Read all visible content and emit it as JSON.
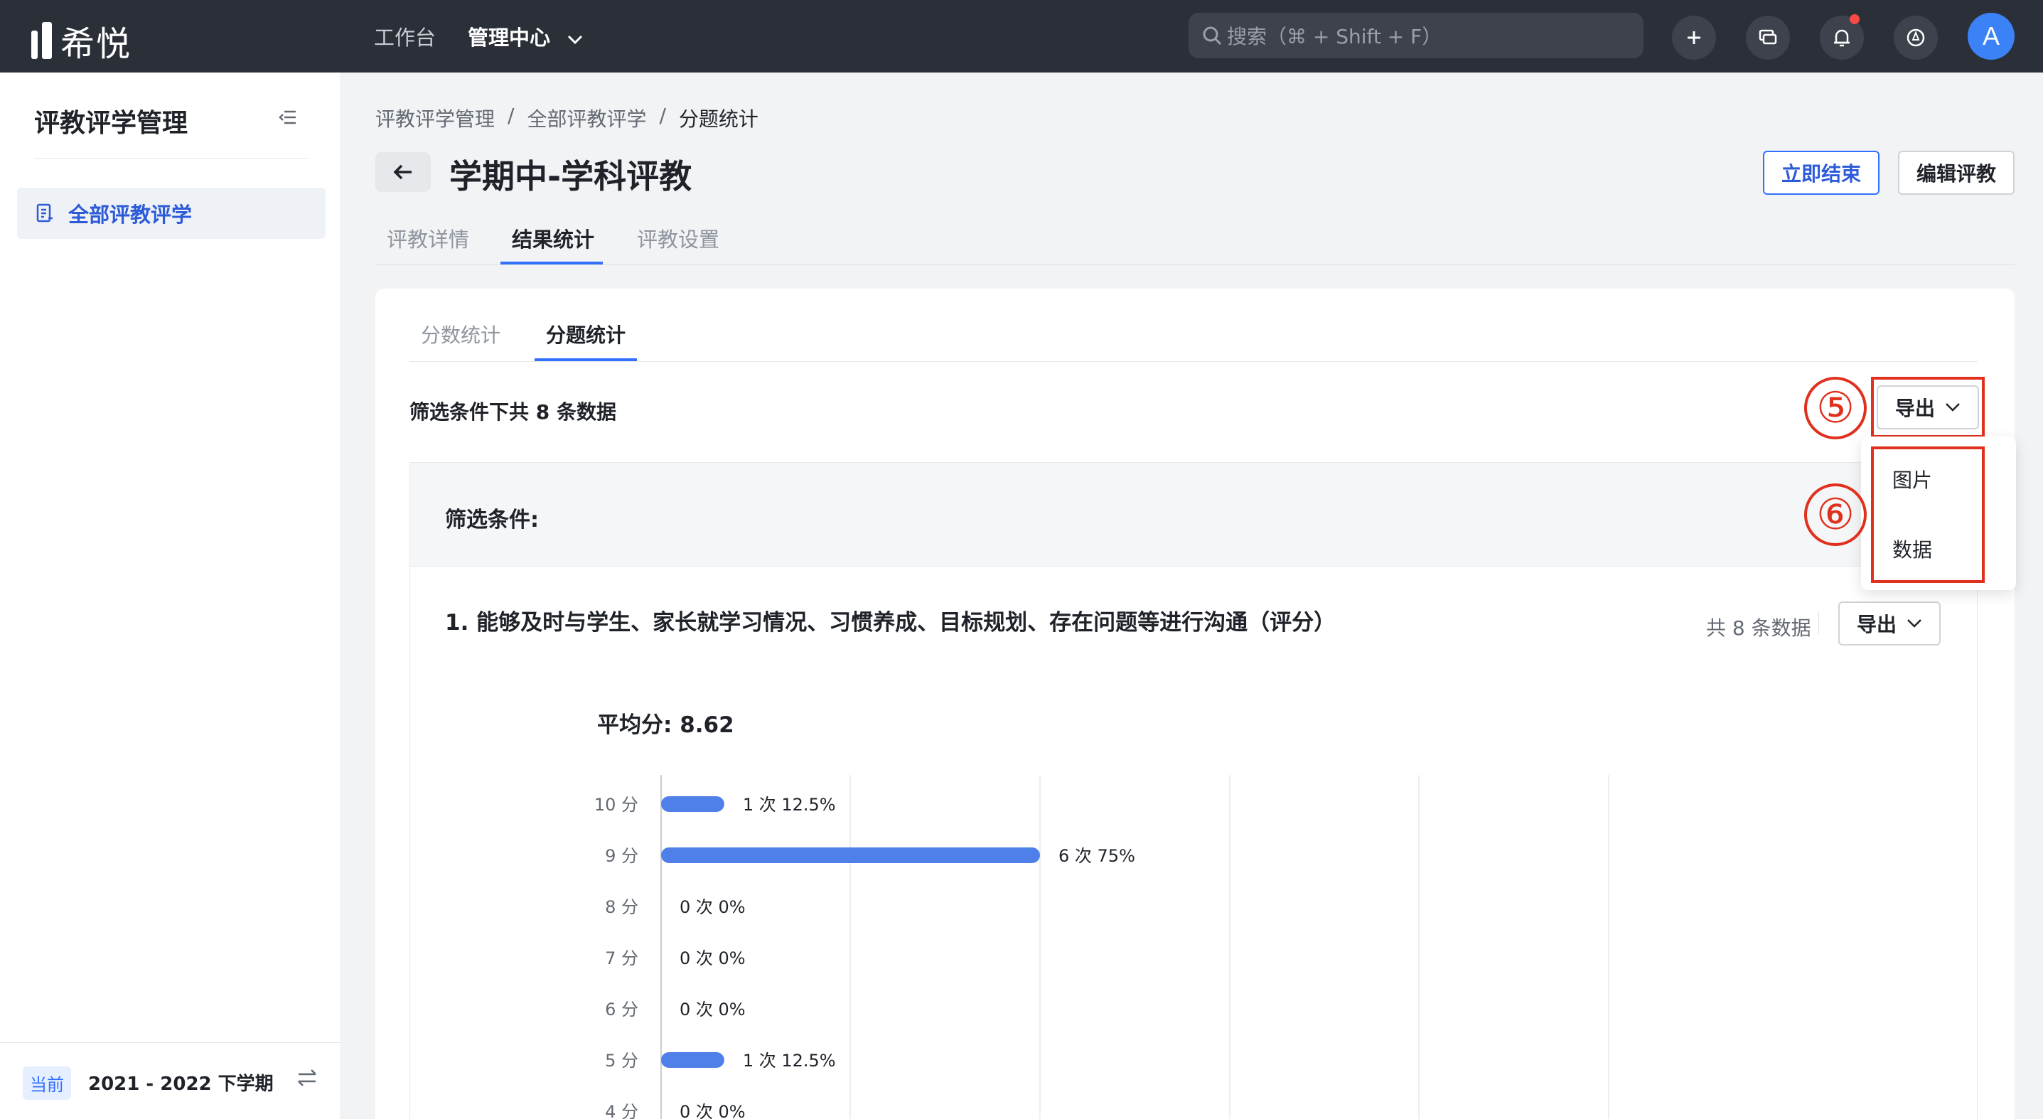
{
  "topnav": {
    "logo_text": "希悦",
    "links": [
      "工作台",
      "管理中心"
    ],
    "search_placeholder": "搜索（⌘ + Shift + F）",
    "avatar_initial": "A"
  },
  "sidebar": {
    "title": "评教评学管理",
    "items": [
      {
        "label": "全部评教评学"
      }
    ],
    "term_badge": "当前",
    "term_text": "2021 - 2022 下学期"
  },
  "breadcrumb": [
    "评教评学管理",
    "/",
    "全部评教评学",
    "/",
    "分题统计"
  ],
  "page": {
    "title": "学期中-学科评教",
    "end_now": "立即结束",
    "edit": "编辑评教",
    "tabs": [
      "评教详情",
      "结果统计",
      "评教设置"
    ]
  },
  "card": {
    "subtabs": [
      "分数统计",
      "分题统计"
    ],
    "count_text": "筛选条件下共 8 条数据",
    "export_label": "导出",
    "export_menu": [
      "图片",
      "数据"
    ],
    "annotations": [
      "⑤",
      "⑥"
    ],
    "filter_label": "筛选条件:",
    "question": {
      "title": "1. 能够及时与学生、家长就学习情况、习惯养成、目标规划、存在问题等进行沟通（评分）",
      "count": "共 8 条数据",
      "export_label": "导出",
      "average": "平均分: 8.62"
    }
  },
  "colors": {
    "accent": "#3370ff",
    "bar": "#4f7fe8",
    "annotation": "#e0301e",
    "nav_bg": "#2b2f38"
  },
  "chart_data": {
    "type": "bar",
    "orientation": "horizontal",
    "categories": [
      "10 分",
      "9 分",
      "8 分",
      "7 分",
      "6 分",
      "5 分",
      "4 分"
    ],
    "values": [
      1,
      6,
      0,
      0,
      0,
      1,
      0
    ],
    "percent_labels": [
      "1 次 12.5%",
      "6 次 75%",
      "0 次 0%",
      "0 次 0%",
      "0 次 0%",
      "1 次 12.5%",
      "0 次 0%"
    ],
    "xlim": [
      0,
      6
    ],
    "grid": true
  }
}
